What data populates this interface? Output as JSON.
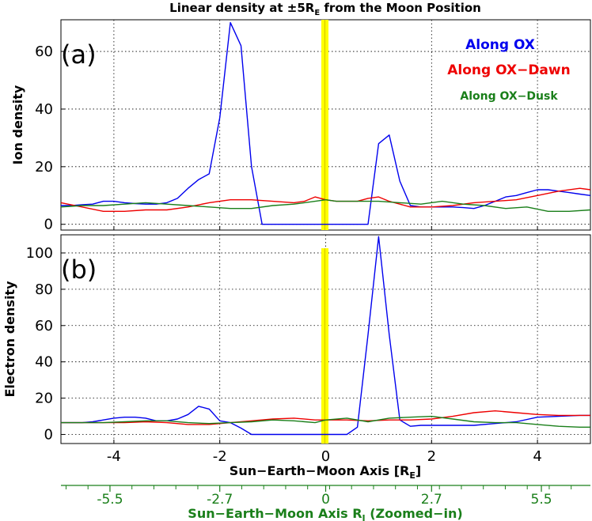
{
  "title": "Linear density at ±5R",
  "title_sub": "E",
  "title_suffix": " from the Moon Position",
  "colors": {
    "ox": "#0000ee",
    "dawn": "#ee0000",
    "dusk": "#1a7f1a",
    "moon_band": "#ffff00",
    "moon_line": "#d4c400"
  },
  "legend": [
    {
      "name": "Along OX",
      "color": "#0000ee"
    },
    {
      "name": "Along OX−Dawn",
      "color": "#ee0000"
    },
    {
      "name": "Along OX−Dusk",
      "color": "#1a7f1a"
    }
  ],
  "chart_data": [
    {
      "type": "line",
      "panel_label": "(a)",
      "ylabel": "Ion density",
      "xlim": [
        -5,
        5
      ],
      "ylim": [
        -2,
        71
      ],
      "yticks": [
        0,
        20,
        40,
        60
      ],
      "grid": true,
      "series": [
        {
          "name": "Along OX",
          "x": [
            -5,
            -4.8,
            -4.6,
            -4.4,
            -4.2,
            -4.0,
            -3.8,
            -3.6,
            -3.4,
            -3.2,
            -3.0,
            -2.8,
            -2.6,
            -2.4,
            -2.2,
            -2.0,
            -1.8,
            -1.6,
            -1.4,
            -1.2,
            -1.0,
            -0.8,
            -0.6,
            -0.4,
            -0.2,
            0,
            0.2,
            0.4,
            0.6,
            0.8,
            1.0,
            1.2,
            1.4,
            1.6,
            1.8,
            2.0,
            2.2,
            2.4,
            2.6,
            2.8,
            3.0,
            3.2,
            3.4,
            3.6,
            3.8,
            4.0,
            4.2,
            4.4,
            4.6,
            4.8,
            5.0
          ],
          "y": [
            6.5,
            6.5,
            6.8,
            7.0,
            8.0,
            8.0,
            7.5,
            7.2,
            7.0,
            7.0,
            7.5,
            9.0,
            12.5,
            15.5,
            17.5,
            37,
            70,
            62,
            20,
            0,
            0,
            0,
            0,
            0,
            0,
            0,
            0,
            0,
            0,
            0,
            28,
            31,
            15,
            6.5,
            6.0,
            6.0,
            6.0,
            6.0,
            5.8,
            5.5,
            6.5,
            8.0,
            9.5,
            10.0,
            11.0,
            12.0,
            12.0,
            11.5,
            11.0,
            10.5,
            10.0
          ]
        },
        {
          "name": "Along OX−Dawn",
          "x": [
            -5,
            -4.6,
            -4.2,
            -3.8,
            -3.4,
            -3.0,
            -2.6,
            -2.2,
            -1.8,
            -1.4,
            -1.0,
            -0.6,
            -0.4,
            -0.2,
            0,
            0.2,
            0.4,
            0.6,
            0.8,
            1.0,
            1.2,
            1.4,
            1.6,
            2.0,
            2.4,
            2.8,
            3.2,
            3.6,
            4.0,
            4.4,
            4.8,
            5.0
          ],
          "y": [
            7.5,
            6.0,
            4.5,
            4.5,
            5.0,
            5.0,
            6.0,
            7.5,
            8.5,
            8.5,
            8.0,
            7.5,
            8.0,
            9.5,
            8.5,
            8.0,
            8.0,
            8.0,
            9.0,
            9.5,
            8.0,
            7.0,
            6.0,
            6.0,
            6.5,
            7.5,
            8.0,
            8.5,
            10.0,
            11.5,
            12.5,
            12.0
          ]
        },
        {
          "name": "Along OX−Dusk",
          "x": [
            -5,
            -4.6,
            -4.2,
            -3.8,
            -3.4,
            -3.0,
            -2.6,
            -2.2,
            -1.8,
            -1.4,
            -1.0,
            -0.6,
            -0.2,
            0,
            0.2,
            0.6,
            1.0,
            1.4,
            1.8,
            2.2,
            2.6,
            3.0,
            3.4,
            3.8,
            4.2,
            4.6,
            5.0
          ],
          "y": [
            6.0,
            6.5,
            6.5,
            7.0,
            7.5,
            7.0,
            6.5,
            6.0,
            5.5,
            5.5,
            6.5,
            7.0,
            8.0,
            8.5,
            8.0,
            8.0,
            8.0,
            7.5,
            7.0,
            8.0,
            7.0,
            6.5,
            5.5,
            6.0,
            4.5,
            4.5,
            5.0
          ]
        }
      ]
    },
    {
      "type": "line",
      "panel_label": "(b)",
      "ylabel": "Electron density",
      "xlabel": "Sun−Earth−Moon Axis [R",
      "xlabel_sub": "E",
      "xlabel_suffix": "]",
      "xlim": [
        -5,
        5
      ],
      "ylim": [
        -5,
        110
      ],
      "yticks": [
        0,
        20,
        40,
        60,
        80,
        100
      ],
      "xticks": [
        -4,
        -2,
        0,
        2,
        4
      ],
      "grid": true,
      "series": [
        {
          "name": "Along OX",
          "x": [
            -5,
            -4.6,
            -4.4,
            -4.2,
            -4.0,
            -3.8,
            -3.6,
            -3.4,
            -3.2,
            -3.0,
            -2.8,
            -2.6,
            -2.4,
            -2.2,
            -2.0,
            -1.8,
            -1.6,
            -1.4,
            -1.2,
            -1.0,
            -0.8,
            -0.6,
            -0.4,
            -0.2,
            0,
            0.2,
            0.4,
            0.6,
            0.8,
            1.0,
            1.2,
            1.4,
            1.6,
            1.8,
            2.0,
            2.4,
            2.8,
            3.2,
            3.6,
            4.0,
            4.4,
            4.8,
            5.0
          ],
          "y": [
            6.5,
            6.5,
            7.0,
            8.0,
            9.0,
            9.5,
            9.5,
            9.0,
            7.5,
            7.5,
            8.5,
            11.0,
            15.5,
            14.0,
            7.5,
            6.5,
            3.5,
            0,
            0,
            0,
            0,
            0,
            0,
            0,
            0,
            0,
            0,
            4.0,
            55,
            109,
            55,
            8.0,
            4.5,
            5.0,
            5.0,
            5.0,
            5.0,
            6.0,
            7.0,
            9.5,
            10.0,
            10.5,
            10.5
          ]
        },
        {
          "name": "Along OX−Dawn",
          "x": [
            -5,
            -4.6,
            -4.2,
            -3.8,
            -3.4,
            -3.0,
            -2.6,
            -2.2,
            -1.8,
            -1.4,
            -1.0,
            -0.6,
            -0.2,
            0,
            0.4,
            0.8,
            1.2,
            1.6,
            2.0,
            2.4,
            2.8,
            3.2,
            3.6,
            4.0,
            4.4,
            4.8,
            5.0
          ],
          "y": [
            6.5,
            6.5,
            6.5,
            6.5,
            7.0,
            6.5,
            5.5,
            5.5,
            6.5,
            7.5,
            8.5,
            9.0,
            8.0,
            8.0,
            8.0,
            7.5,
            8.0,
            8.0,
            8.5,
            10.0,
            12.0,
            13.0,
            12.0,
            11.0,
            10.5,
            10.5,
            10.5
          ]
        },
        {
          "name": "Along OX−Dusk",
          "x": [
            -5,
            -4.6,
            -4.2,
            -3.8,
            -3.4,
            -3.0,
            -2.6,
            -2.2,
            -1.8,
            -1.4,
            -1.0,
            -0.6,
            -0.2,
            0,
            0.4,
            0.8,
            1.2,
            1.6,
            2.0,
            2.4,
            2.8,
            3.2,
            3.6,
            4.0,
            4.4,
            4.8,
            5.0
          ],
          "y": [
            6.5,
            6.5,
            6.5,
            7.0,
            7.5,
            7.5,
            6.5,
            6.0,
            6.5,
            7.0,
            8.0,
            7.5,
            6.5,
            8.0,
            9.0,
            7.0,
            9.0,
            9.5,
            10.0,
            8.5,
            7.0,
            6.5,
            6.5,
            5.5,
            4.5,
            4.0,
            4.0
          ]
        }
      ]
    }
  ],
  "secondary_axis": {
    "xlabel": "Sun−Earth−Moon Axis R",
    "xlabel_sub": "I",
    "xlabel_suffix": " (Zoomed−in)",
    "ticks": [
      {
        "at": -4.074,
        "label": "-5.5"
      },
      {
        "at": -2.0,
        "label": "-2.7"
      },
      {
        "at": 0,
        "label": "0"
      },
      {
        "at": 2.0,
        "label": "2.7"
      },
      {
        "at": 4.074,
        "label": "5.5"
      }
    ]
  }
}
